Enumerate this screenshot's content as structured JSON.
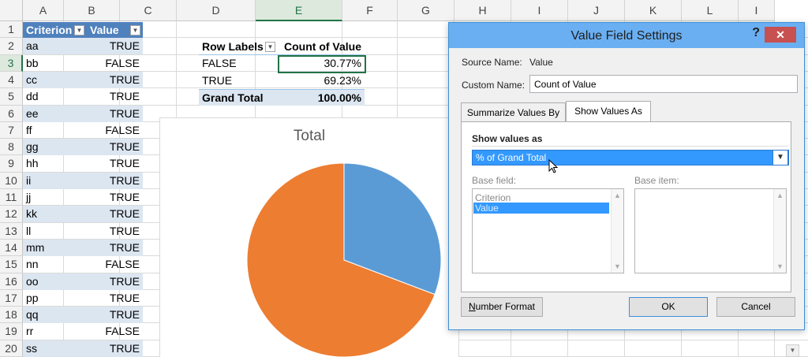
{
  "columns": [
    "A",
    "B",
    "C",
    "D",
    "E",
    "F",
    "G",
    "H",
    "I",
    "J",
    "K",
    "L",
    "I"
  ],
  "selected_column": "E",
  "rows": [
    "1",
    "2",
    "3",
    "4",
    "5",
    "6",
    "7",
    "8",
    "9",
    "10",
    "11",
    "12",
    "13",
    "14",
    "15",
    "16",
    "17",
    "18",
    "19",
    "20"
  ],
  "selected_row": "3",
  "source_table": {
    "headers": [
      "Criterion",
      "Value"
    ],
    "rows": [
      [
        "aa",
        "TRUE"
      ],
      [
        "bb",
        "FALSE"
      ],
      [
        "cc",
        "TRUE"
      ],
      [
        "dd",
        "TRUE"
      ],
      [
        "ee",
        "TRUE"
      ],
      [
        "ff",
        "FALSE"
      ],
      [
        "gg",
        "TRUE"
      ],
      [
        "hh",
        "TRUE"
      ],
      [
        "ii",
        "TRUE"
      ],
      [
        "jj",
        "TRUE"
      ],
      [
        "kk",
        "TRUE"
      ],
      [
        "ll",
        "TRUE"
      ],
      [
        "mm",
        "TRUE"
      ],
      [
        "nn",
        "FALSE"
      ],
      [
        "oo",
        "TRUE"
      ],
      [
        "pp",
        "TRUE"
      ],
      [
        "qq",
        "TRUE"
      ],
      [
        "rr",
        "FALSE"
      ],
      [
        "ss",
        "TRUE"
      ]
    ]
  },
  "pivot": {
    "header_row_labels": "Row Labels",
    "header_count": "Count of Value",
    "rows": [
      {
        "label": "FALSE",
        "value": "30.77%"
      },
      {
        "label": "TRUE",
        "value": "69.23%"
      }
    ],
    "grand_total_label": "Grand Total",
    "grand_total_value": "100.00%"
  },
  "chart_data": {
    "type": "pie",
    "title": "Total",
    "categories": [
      "FALSE",
      "TRUE"
    ],
    "values": [
      30.77,
      69.23
    ],
    "colors": [
      "#5b9bd5",
      "#ed7d31"
    ],
    "legend": "none"
  },
  "dialog": {
    "title": "Value Field Settings",
    "help": "?",
    "close": "✕",
    "source_name_label": "Source Name:",
    "source_name_value": "Value",
    "custom_name_label": "Custom Name:",
    "custom_name_value": "Count of Value",
    "tabs": [
      "Summarize Values By",
      "Show Values As"
    ],
    "active_tab": "Show Values As",
    "show_values_as_label": "Show values as",
    "show_values_as_selected": "% of Grand Total",
    "base_field_label": "Base field:",
    "base_field_items": [
      "Criterion",
      "Value"
    ],
    "base_field_selected": "Value",
    "base_item_label": "Base item:",
    "number_format_button": "Number Format",
    "ok_button": "OK",
    "cancel_button": "Cancel"
  }
}
